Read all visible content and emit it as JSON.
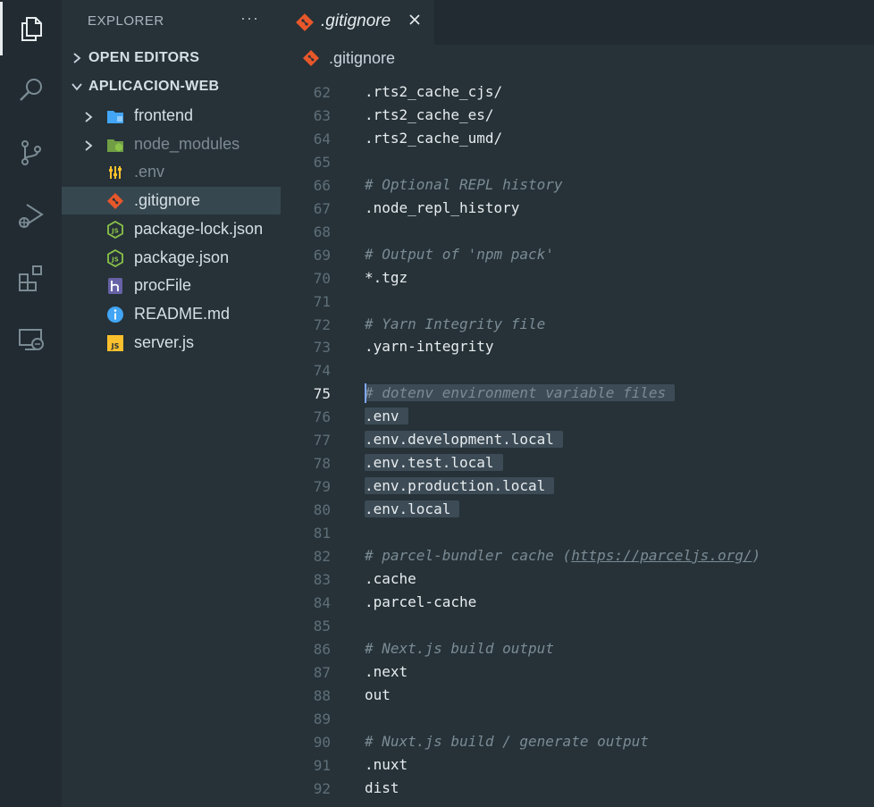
{
  "activity_bar": {
    "items": [
      {
        "name": "explorer-icon",
        "active": true
      },
      {
        "name": "search-icon",
        "active": false
      },
      {
        "name": "source-control-icon",
        "active": false
      },
      {
        "name": "run-debug-icon",
        "active": false
      },
      {
        "name": "extensions-icon",
        "active": false
      },
      {
        "name": "remote-explorer-icon",
        "active": false
      }
    ]
  },
  "sidebar": {
    "title": "EXPLORER",
    "more": "···",
    "open_editors": "OPEN EDITORS",
    "project": "APLICACION-WEB",
    "tree": [
      {
        "label": "frontend",
        "icon": "folder-icon",
        "chevron": true,
        "dim": false,
        "selected": false
      },
      {
        "label": "node_modules",
        "icon": "node-folder-icon",
        "chevron": true,
        "dim": true,
        "selected": false
      },
      {
        "label": ".env",
        "icon": "settings-sliders-icon",
        "chevron": false,
        "dim": true,
        "selected": false
      },
      {
        "label": ".gitignore",
        "icon": "git-icon",
        "chevron": false,
        "dim": false,
        "selected": true
      },
      {
        "label": "package-lock.json",
        "icon": "nodejs-icon",
        "chevron": false,
        "dim": false,
        "selected": false
      },
      {
        "label": "package.json",
        "icon": "nodejs-icon",
        "chevron": false,
        "dim": false,
        "selected": false
      },
      {
        "label": "procFile",
        "icon": "heroku-icon",
        "chevron": false,
        "dim": false,
        "selected": false
      },
      {
        "label": "README.md",
        "icon": "info-icon",
        "chevron": false,
        "dim": false,
        "selected": false
      },
      {
        "label": "server.js",
        "icon": "javascript-icon",
        "chevron": false,
        "dim": false,
        "selected": false
      }
    ]
  },
  "editor": {
    "tab": {
      "label": ".gitignore",
      "close": "×"
    },
    "breadcrumb": ".gitignore",
    "current_line": 75,
    "lines": [
      {
        "n": "62",
        "text": ".rts2_cache_cjs/",
        "kind": "code"
      },
      {
        "n": "63",
        "text": ".rts2_cache_es/",
        "kind": "code"
      },
      {
        "n": "64",
        "text": ".rts2_cache_umd/",
        "kind": "code"
      },
      {
        "n": "65",
        "text": "",
        "kind": "code"
      },
      {
        "n": "66",
        "text": "# Optional REPL history",
        "kind": "comment"
      },
      {
        "n": "67",
        "text": ".node_repl_history",
        "kind": "code"
      },
      {
        "n": "68",
        "text": "",
        "kind": "code"
      },
      {
        "n": "69",
        "text": "# Output of 'npm pack'",
        "kind": "comment"
      },
      {
        "n": "70",
        "text": "*.tgz",
        "kind": "code"
      },
      {
        "n": "71",
        "text": "",
        "kind": "code"
      },
      {
        "n": "72",
        "text": "# Yarn Integrity file",
        "kind": "comment"
      },
      {
        "n": "73",
        "text": ".yarn-integrity",
        "kind": "code"
      },
      {
        "n": "74",
        "text": "",
        "kind": "code"
      },
      {
        "n": "75",
        "text": "# dotenv environment variable files",
        "kind": "comment",
        "selected": true
      },
      {
        "n": "76",
        "text": ".env",
        "kind": "code",
        "selected": true
      },
      {
        "n": "77",
        "text": ".env.development.local",
        "kind": "code",
        "selected": true
      },
      {
        "n": "78",
        "text": ".env.test.local",
        "kind": "code",
        "selected": true
      },
      {
        "n": "79",
        "text": ".env.production.local",
        "kind": "code",
        "selected": true
      },
      {
        "n": "80",
        "text": ".env.local",
        "kind": "code",
        "selected": true
      },
      {
        "n": "81",
        "text": "",
        "kind": "code"
      },
      {
        "n": "82",
        "text": "# parcel-bundler cache (",
        "kind": "comment",
        "url": "https://parceljs.org/",
        "after": ")"
      },
      {
        "n": "83",
        "text": ".cache",
        "kind": "code"
      },
      {
        "n": "84",
        "text": ".parcel-cache",
        "kind": "code"
      },
      {
        "n": "85",
        "text": "",
        "kind": "code"
      },
      {
        "n": "86",
        "text": "# Next.js build output",
        "kind": "comment"
      },
      {
        "n": "87",
        "text": ".next",
        "kind": "code"
      },
      {
        "n": "88",
        "text": "out",
        "kind": "code"
      },
      {
        "n": "89",
        "text": "",
        "kind": "code"
      },
      {
        "n": "90",
        "text": "# Nuxt.js build / generate output",
        "kind": "comment"
      },
      {
        "n": "91",
        "text": ".nuxt",
        "kind": "code"
      },
      {
        "n": "92",
        "text": "dist",
        "kind": "code"
      }
    ]
  },
  "colors": {
    "background": "#263238",
    "activity_bar": "#212b31",
    "selection": "#3c4b55",
    "git_orange": "#e8572a",
    "node_green": "#8bc34a",
    "folder_blue": "#42a5f5"
  }
}
